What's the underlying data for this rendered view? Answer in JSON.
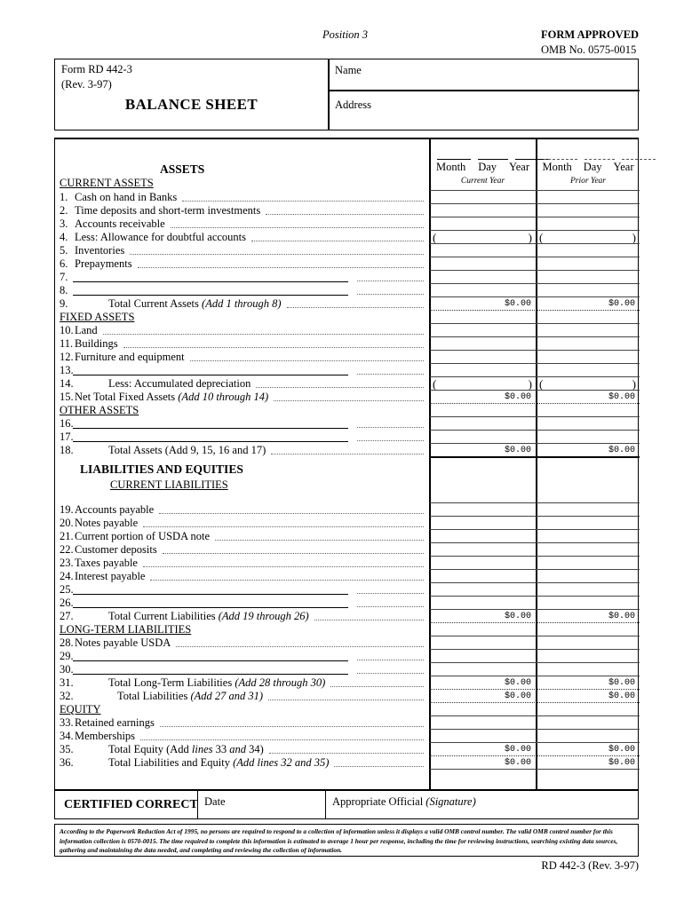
{
  "header": {
    "position": "Position 3",
    "form_approved": "FORM APPROVED",
    "omb_no": "OMB No. 0575-0015"
  },
  "title_block": {
    "form_number": "Form RD 442-3",
    "revision": "(Rev. 3-97)",
    "title": "BALANCE SHEET",
    "name_label": "Name",
    "address_label": "Address"
  },
  "columns": {
    "current": {
      "month": "Month",
      "day": "Day",
      "year": "Year",
      "caption": "Current Year"
    },
    "prior": {
      "month": "Month",
      "day": "Day",
      "year": "Year",
      "caption": "Prior Year"
    }
  },
  "sections": {
    "assets_heading": "ASSETS",
    "current_assets": "CURRENT ASSETS",
    "fixed_assets": "FIXED ASSETS",
    "other_assets": "OTHER ASSETS",
    "liabilities_and_equities": "LIABILITIES AND EQUITIES",
    "current_liabilities": "CURRENT LIABILITIES",
    "long_term_liabilities": "LONG-TERM LIABILITIES",
    "equity": "EQUITY"
  },
  "lines": [
    {
      "num": "1.",
      "text": "Cash on hand in Banks",
      "italic": "",
      "current": "",
      "prior": ""
    },
    {
      "num": "2.",
      "text": "Time deposits and short-term investments",
      "italic": "",
      "current": "",
      "prior": ""
    },
    {
      "num": "3.",
      "text": "Accounts receivable",
      "italic": "",
      "current": "",
      "prior": ""
    },
    {
      "num": "4.",
      "text": "Less: Allowance for doubtful accounts",
      "italic": "",
      "current": "",
      "prior": ""
    },
    {
      "num": "5.",
      "text": "Inventories",
      "italic": "",
      "current": "",
      "prior": ""
    },
    {
      "num": "6.",
      "text": "Prepayments",
      "italic": "",
      "current": "",
      "prior": ""
    },
    {
      "num": "7.",
      "text": "",
      "italic": "",
      "current": "",
      "prior": ""
    },
    {
      "num": "8.",
      "text": "",
      "italic": "",
      "current": "",
      "prior": ""
    },
    {
      "num": "9.",
      "text": "Total Current Assets ",
      "italic": "(Add 1 through 8)",
      "current": "$0.00",
      "prior": "$0.00"
    },
    {
      "num": "10.",
      "text": "Land",
      "italic": "",
      "current": "",
      "prior": ""
    },
    {
      "num": "11.",
      "text": "Buildings",
      "italic": "",
      "current": "",
      "prior": ""
    },
    {
      "num": "12.",
      "text": "Furniture and equipment",
      "italic": "",
      "current": "",
      "prior": ""
    },
    {
      "num": "13.",
      "text": "",
      "italic": "",
      "current": "",
      "prior": ""
    },
    {
      "num": "14.",
      "text": "Less: Accumulated depreciation",
      "italic": "",
      "current": "",
      "prior": ""
    },
    {
      "num": "15.",
      "text": "Net Total Fixed Assets ",
      "italic": "(Add 10 through 14)",
      "current": "$0.00",
      "prior": "$0.00"
    },
    {
      "num": "16.",
      "text": "",
      "italic": "",
      "current": "",
      "prior": ""
    },
    {
      "num": "17.",
      "text": "",
      "italic": "",
      "current": "",
      "prior": ""
    },
    {
      "num": "18.",
      "text": "Total Assets (Add 9, 15, 16 and 17)",
      "italic": "",
      "current": "$0.00",
      "prior": "$0.00"
    },
    {
      "num": "19.",
      "text": "Accounts payable",
      "italic": "",
      "current": "",
      "prior": ""
    },
    {
      "num": "20.",
      "text": "Notes payable",
      "italic": "",
      "current": "",
      "prior": ""
    },
    {
      "num": "21.",
      "text": "Current portion of USDA note",
      "italic": "",
      "current": "",
      "prior": ""
    },
    {
      "num": "22.",
      "text": "Customer deposits",
      "italic": "",
      "current": "",
      "prior": ""
    },
    {
      "num": "23.",
      "text": "Taxes payable",
      "italic": "",
      "current": "",
      "prior": ""
    },
    {
      "num": "24.",
      "text": "Interest payable",
      "italic": "",
      "current": "",
      "prior": ""
    },
    {
      "num": "25.",
      "text": "",
      "italic": "",
      "current": "",
      "prior": ""
    },
    {
      "num": "26.",
      "text": "",
      "italic": "",
      "current": "",
      "prior": ""
    },
    {
      "num": "27.",
      "text": "Total Current Liabilities ",
      "italic": "(Add 19 through 26)",
      "current": "$0.00",
      "prior": "$0.00"
    },
    {
      "num": "28.",
      "text": "Notes payable USDA",
      "italic": "",
      "current": "",
      "prior": ""
    },
    {
      "num": "29.",
      "text": "",
      "italic": "",
      "current": "",
      "prior": ""
    },
    {
      "num": "30.",
      "text": "",
      "italic": "",
      "current": "",
      "prior": ""
    },
    {
      "num": "31.",
      "text": "Total Long-Term Liabilities ",
      "italic": "(Add 28 through 30)",
      "current": "$0.00",
      "prior": "$0.00"
    },
    {
      "num": "32.",
      "text": "Total Liabilities ",
      "italic": "(Add 27 and 31)",
      "current": "$0.00",
      "prior": "$0.00"
    },
    {
      "num": "33.",
      "text": "Retained earnings",
      "italic": "",
      "current": "",
      "prior": ""
    },
    {
      "num": "34.",
      "text": "Memberships",
      "italic": "",
      "current": "",
      "prior": ""
    },
    {
      "num": "35.",
      "text": "Total Equity (Add lines 33 and 34)",
      "italic": "",
      "current": "$0.00",
      "prior": "$0.00"
    },
    {
      "num": "36.",
      "text": "Total Liabilities and Equity ",
      "italic": "(Add lines 32 and  35)",
      "current": "$0.00",
      "prior": "$0.00"
    }
  ],
  "certify": {
    "certified_correct": "CERTIFIED CORRECT",
    "date_label": "Date",
    "official_label": "Appropriate Official ",
    "official_italic": "(Signature)"
  },
  "fine_print": "According to the Paperwork Reduction Act of 1995, no persons are required to respond to a collection of information unless it displays a valid OMB control number. The valid OMB control number for this information collection is 0570-0015. The time required to complete this information is estimated to average 1 hour per response, including the time for reviewing instructions, searching existing data sources, gathering and maintaining the data needed, and completing and reviewing the collection of information.",
  "footer": {
    "form_id": "RD 442-3 (Rev. 3-97)"
  }
}
